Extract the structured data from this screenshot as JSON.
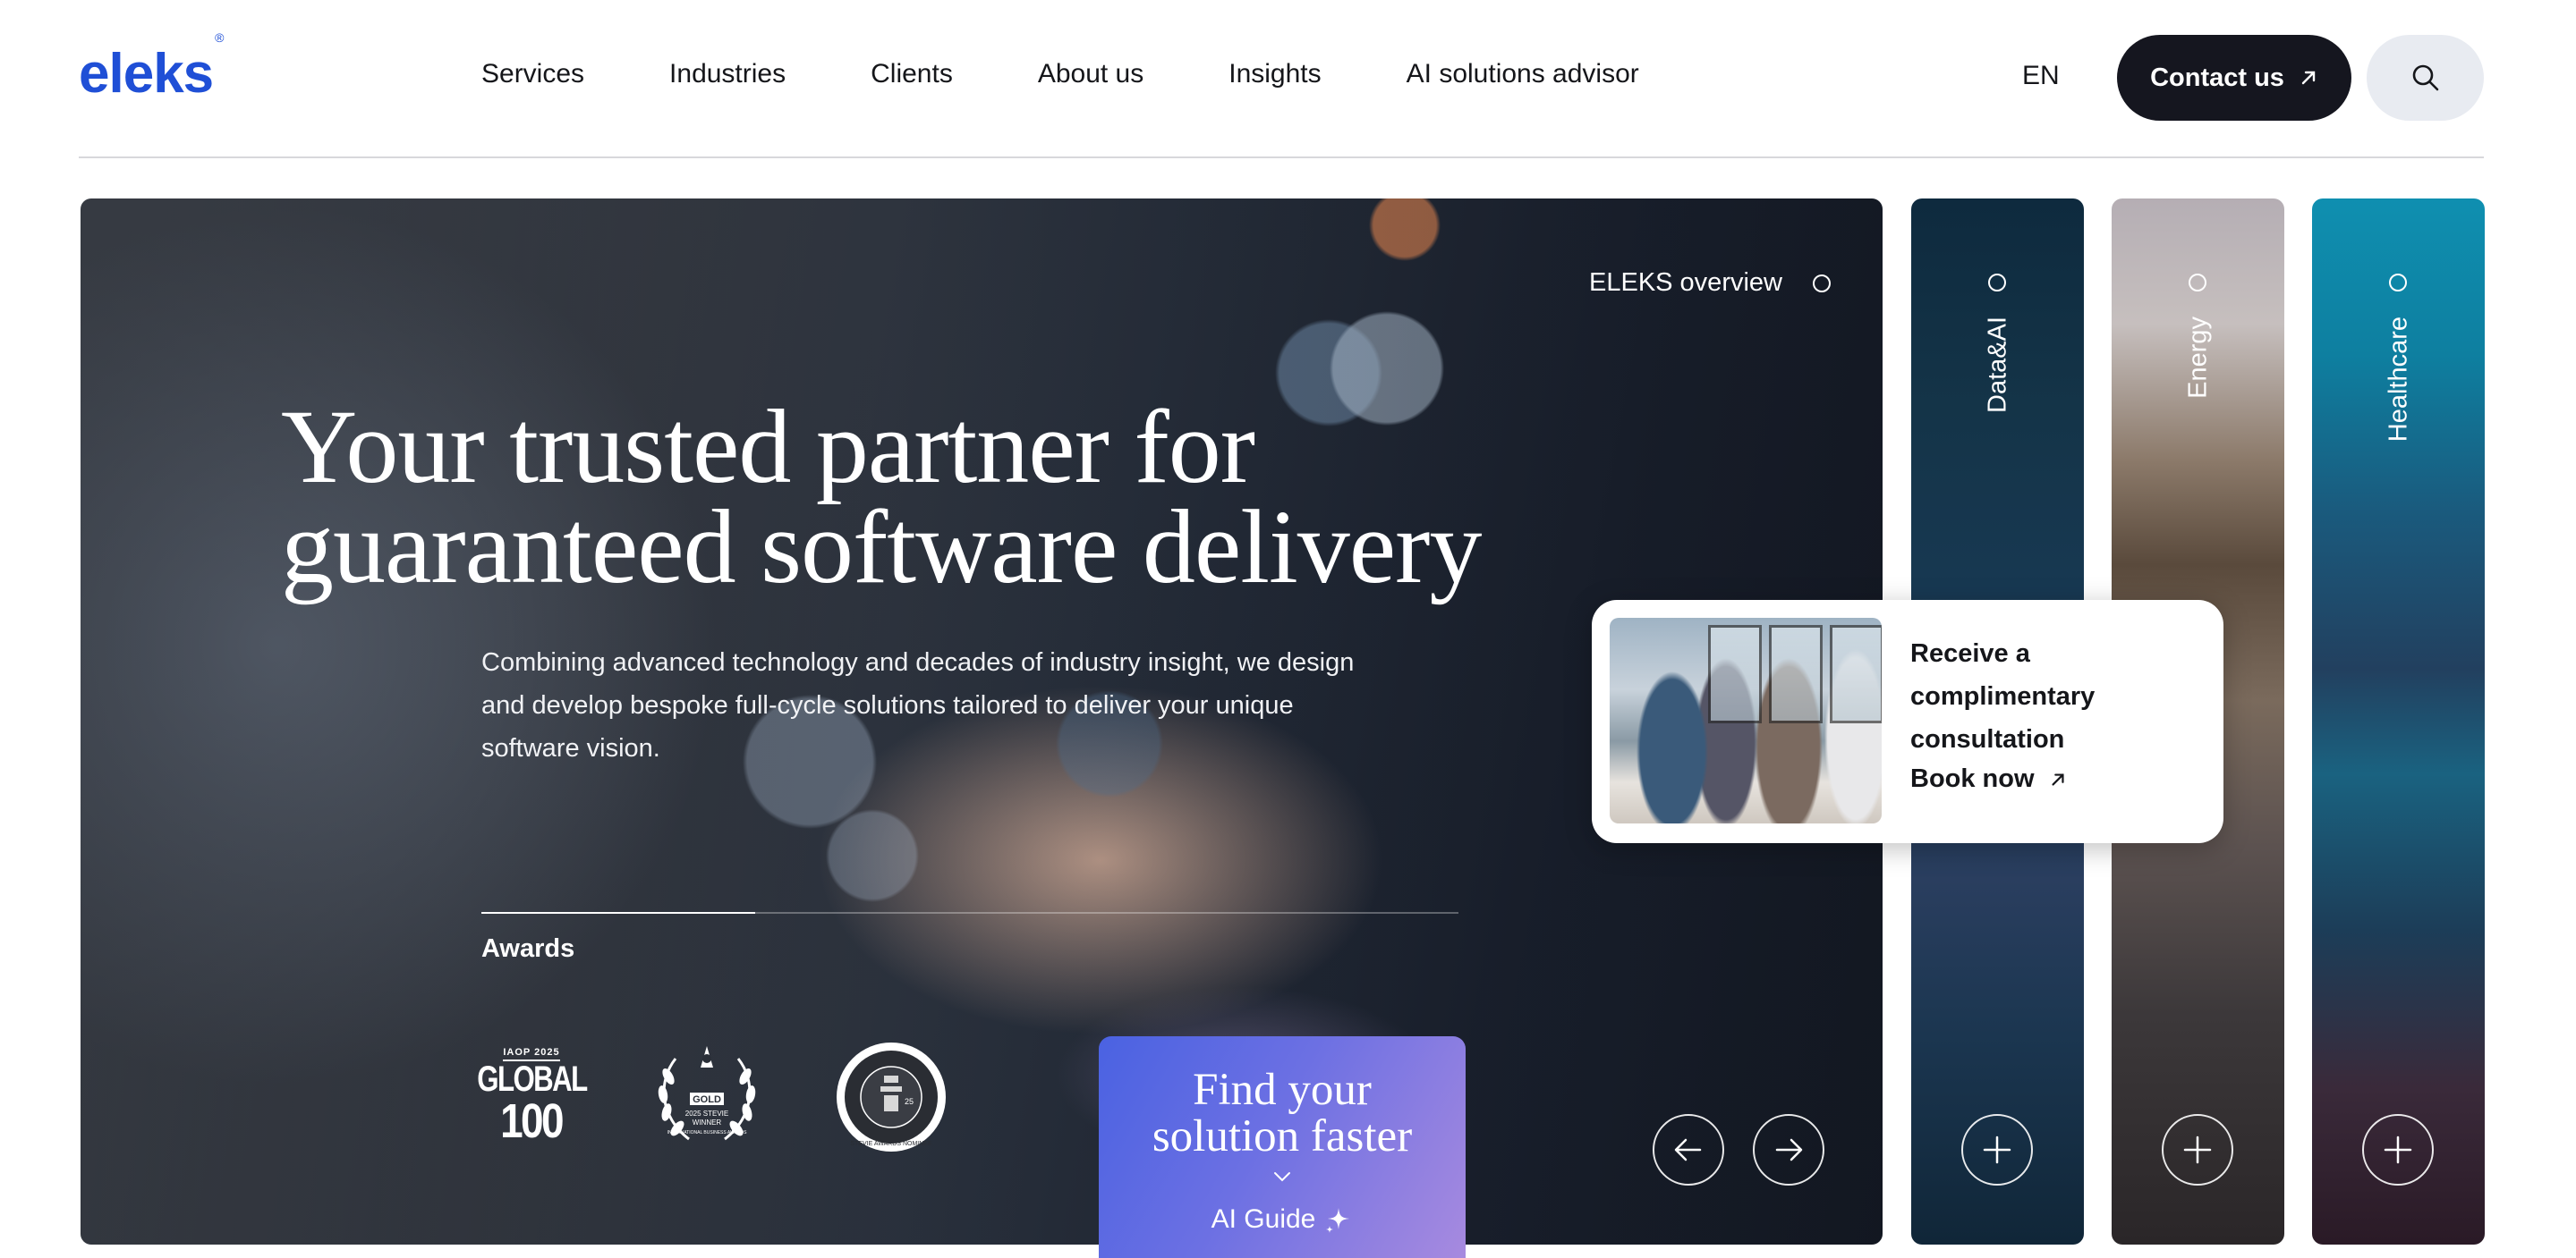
{
  "brand": {
    "logo_text": "eleks",
    "logo_mark": "®",
    "color": "#1f4fd6"
  },
  "nav": {
    "items": [
      "Services",
      "Industries",
      "Clients",
      "About us",
      "Insights",
      "AI solutions advisor"
    ]
  },
  "header": {
    "language": "EN",
    "contact_label": "Contact us",
    "contact_icon": "arrow-up-right-icon",
    "search_icon": "search-icon"
  },
  "hero": {
    "title_line1": "Your trusted partner for",
    "title_line2": "guaranteed software delivery",
    "description": "Combining advanced technology and decades of industry insight, we design and develop bespoke full-cycle solutions tailored to deliver your unique software vision.",
    "awards_label": "Awards",
    "awards": [
      {
        "name": "iaop-global-100",
        "top": "IAOP 2025",
        "line1": "GLOBAL",
        "line2": "100"
      },
      {
        "name": "stevie-gold",
        "badge": "GOLD",
        "line1": "2025 STEVIE",
        "line2": "WINNER",
        "line3": "INTERNATIONAL BUSINESS AWARDS"
      },
      {
        "name": "stevie-seal",
        "ring_text": "STEVIE AWARDS NOMINEE",
        "year": "25"
      }
    ],
    "overview_label": "ELEKS overview"
  },
  "panels": [
    {
      "label": "Data&AI"
    },
    {
      "label": "Energy"
    },
    {
      "label": "Healthcare"
    }
  ],
  "consultation": {
    "line1": "Receive a",
    "line2": "complimentary",
    "line3": "consultation",
    "cta": "Book now"
  },
  "ai_guide": {
    "title_line1": "Find your",
    "title_line2": "solution faster",
    "button": "AI Guide",
    "icon": "sparkle-icon"
  }
}
